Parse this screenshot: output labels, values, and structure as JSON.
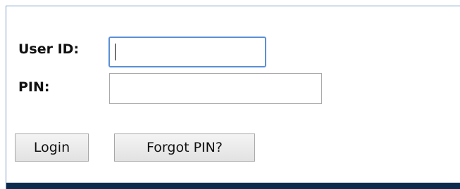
{
  "login_form": {
    "user_id_label": "User ID:",
    "user_id_value": "",
    "pin_label": "PIN:",
    "pin_value": "",
    "login_button": "Login",
    "forgot_pin_button": "Forgot PIN?"
  },
  "colors": {
    "focus_border": "#5b8fd6",
    "footer_bar": "#0d2b4c"
  }
}
